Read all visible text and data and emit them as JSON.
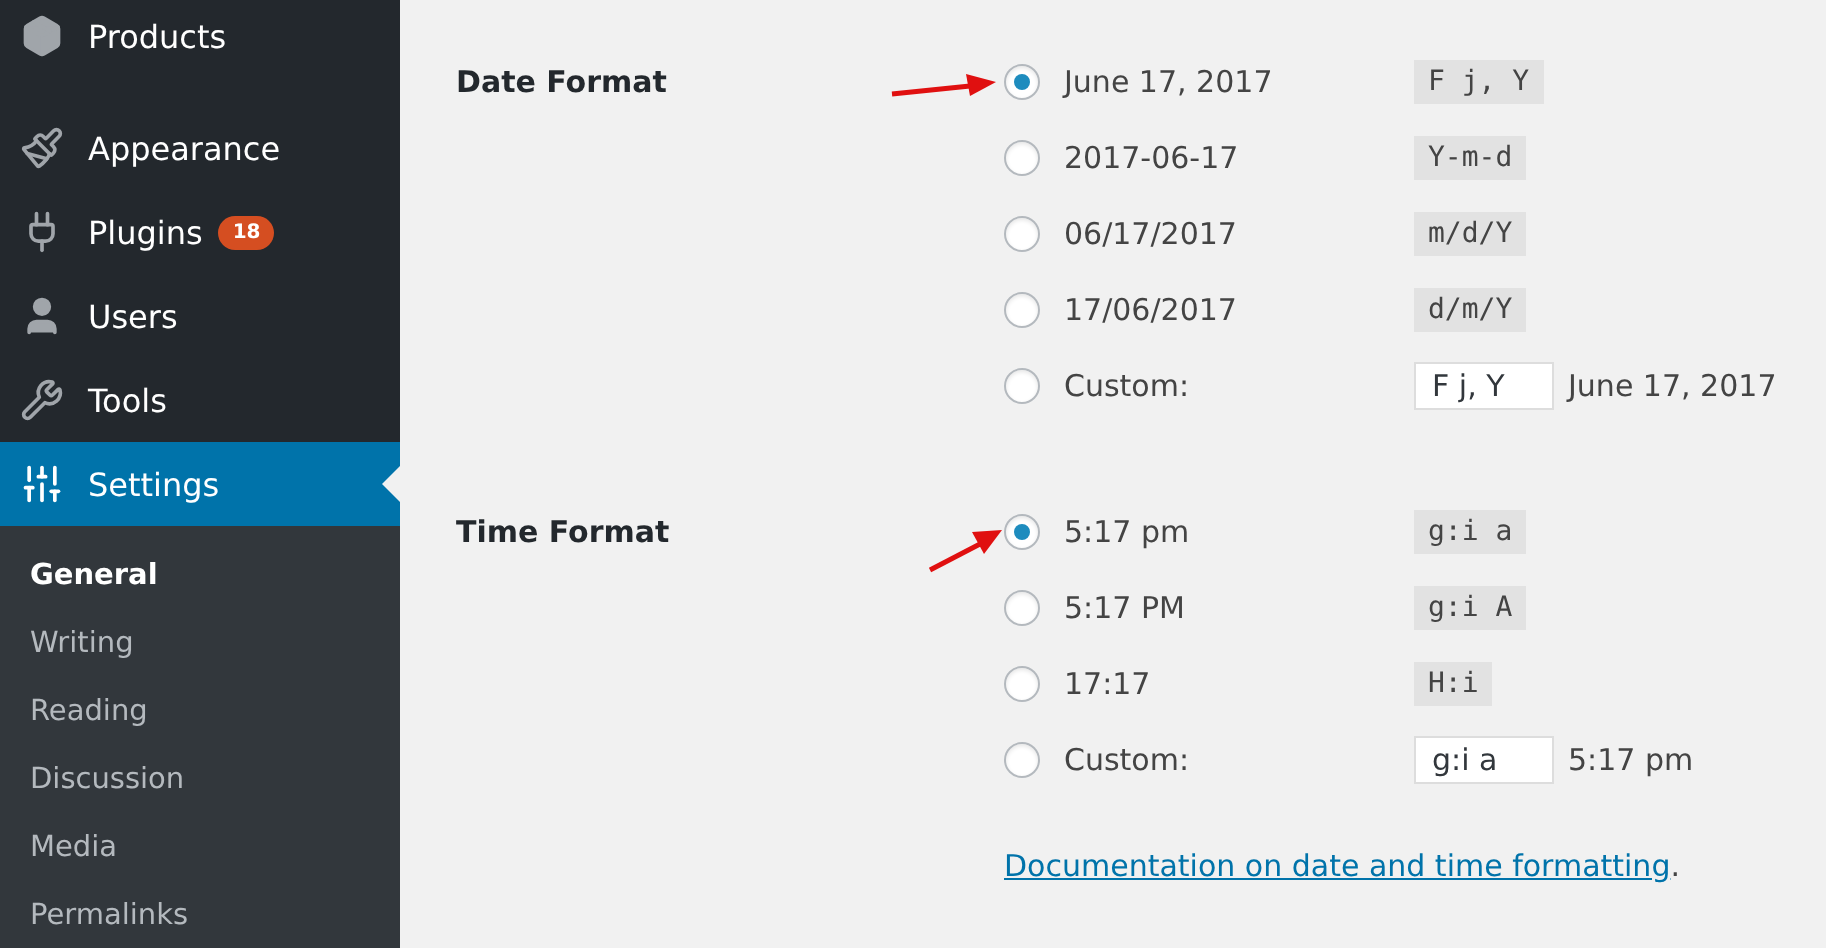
{
  "sidebar": {
    "menu": [
      {
        "label": "Products",
        "selected": false
      },
      {
        "label": "Appearance",
        "selected": false
      },
      {
        "label": "Plugins",
        "badge": "18",
        "selected": false
      },
      {
        "label": "Users",
        "selected": false
      },
      {
        "label": "Tools",
        "selected": false
      },
      {
        "label": "Settings",
        "selected": true
      }
    ],
    "submenu": [
      {
        "label": "General",
        "selected": true
      },
      {
        "label": "Writing",
        "selected": false
      },
      {
        "label": "Reading",
        "selected": false
      },
      {
        "label": "Discussion",
        "selected": false
      },
      {
        "label": "Media",
        "selected": false
      },
      {
        "label": "Permalinks",
        "selected": false
      }
    ]
  },
  "date_format": {
    "label": "Date Format",
    "options": [
      {
        "kind": "preset",
        "label": "June 17, 2017",
        "code": "F j, Y",
        "selected": true
      },
      {
        "kind": "preset",
        "label": "2017-06-17",
        "code": "Y-m-d",
        "selected": false
      },
      {
        "kind": "preset",
        "label": "06/17/2017",
        "code": "m/d/Y",
        "selected": false
      },
      {
        "kind": "preset",
        "label": "17/06/2017",
        "code": "d/m/Y",
        "selected": false
      },
      {
        "kind": "custom",
        "label": "Custom:",
        "value": "F j, Y",
        "preview": "June 17, 2017",
        "selected": false
      }
    ]
  },
  "time_format": {
    "label": "Time Format",
    "options": [
      {
        "kind": "preset",
        "label": "5:17 pm",
        "code": "g:i a",
        "selected": true
      },
      {
        "kind": "preset",
        "label": "5:17 PM",
        "code": "g:i A",
        "selected": false
      },
      {
        "kind": "preset",
        "label": "17:17",
        "code": "H:i",
        "selected": false
      },
      {
        "kind": "custom",
        "label": "Custom:",
        "value": "g:i a",
        "preview": "5:17 pm",
        "selected": false
      }
    ]
  },
  "help": {
    "link": "Documentation on date and time formatting",
    "after": "."
  }
}
